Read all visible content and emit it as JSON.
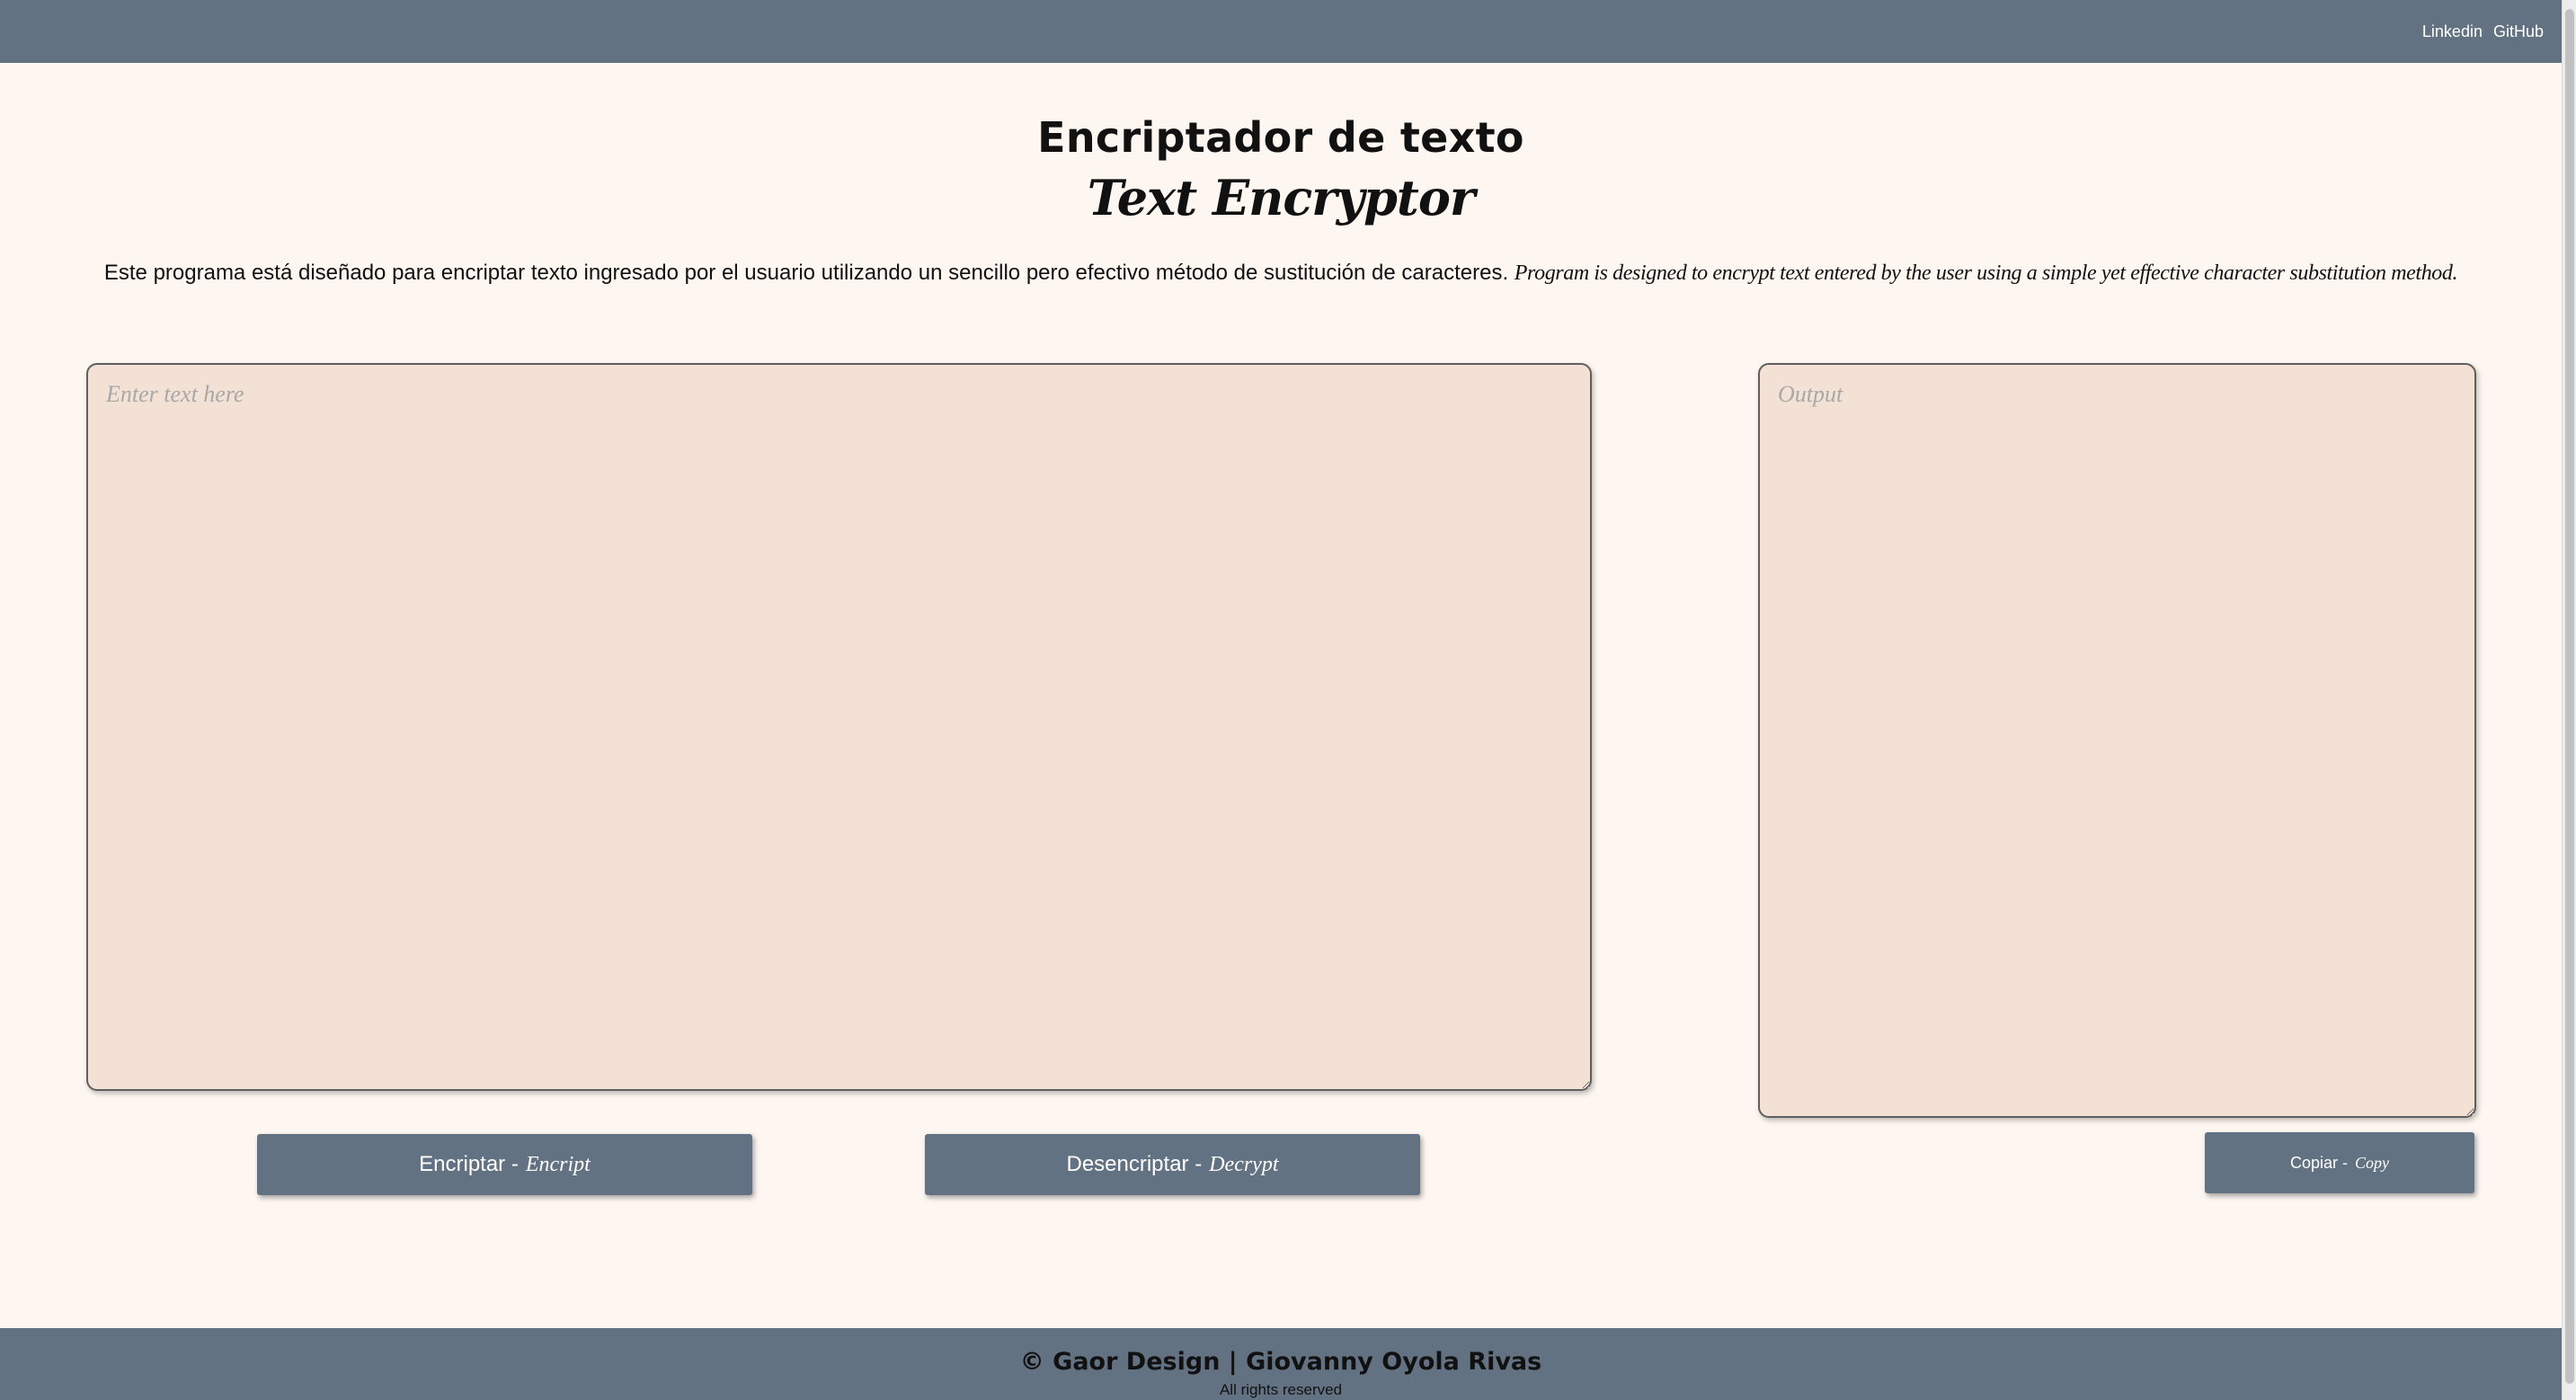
{
  "nav": {
    "links": [
      "Linkedin",
      "GitHub"
    ]
  },
  "header": {
    "title": "Encriptador de texto",
    "subtitle": "Text Encryptor"
  },
  "description": {
    "es": "Este programa está diseñado para encriptar texto ingresado por el usuario utilizando un sencillo pero efectivo método de sustitución de caracteres.",
    "en": "Program is designed to encrypt text entered by the user using a simple yet effective character substitution method."
  },
  "input": {
    "placeholder": "Enter text here",
    "value": ""
  },
  "output": {
    "placeholder": "Output",
    "value": ""
  },
  "buttons": {
    "encrypt": {
      "label": "Encriptar -",
      "alt": "Encript"
    },
    "decrypt": {
      "label": "Desencriptar -",
      "alt": "Decrypt"
    },
    "copy": {
      "label": "Copiar -",
      "alt": "Copy"
    }
  },
  "footer": {
    "copyright": "© Gaor Design | Giovanny Oyola Rivas",
    "rights": "All rights reserved"
  },
  "colors": {
    "nav": "#637282",
    "background": "#fdf6f1",
    "textarea": "#f4e1d6",
    "button": "#637282"
  }
}
